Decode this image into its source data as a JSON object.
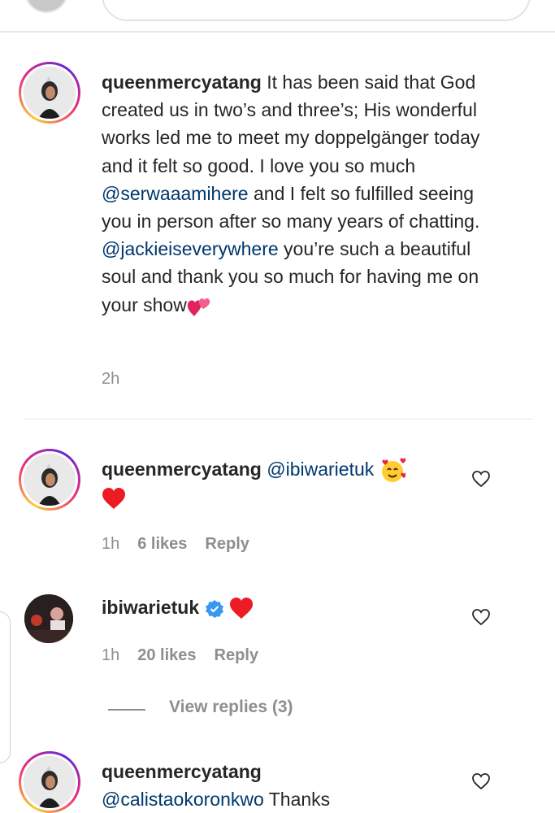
{
  "comments": [
    {
      "username": "queenmercyatang",
      "text_1": " It has been said that God created us in two’s and three’s; His wonderful works led me to meet my doppelgänger today and it felt so good. I love you so much ",
      "mention_1": "@serwaaamihere",
      "text_2": " and I felt so fulfilled seeing you in person after so many years of chatting. ",
      "mention_2": "@jackieiseverywhere",
      "text_3": " you’re such a beautiful soul and thank you so much for having me on your show",
      "time": "2h"
    },
    {
      "username": "queenmercyatang",
      "mention": "@ibiwarietuk",
      "time": "1h",
      "likes": "6 likes",
      "reply_label": "Reply"
    },
    {
      "username": "ibiwarietuk",
      "verified": true,
      "time": "1h",
      "likes": "20 likes",
      "reply_label": "Reply"
    },
    {
      "username": "queenmercyatang",
      "mention": "@calistaokoronkwo",
      "text": " Thanks"
    }
  ],
  "view_replies_label": "View replies (3)",
  "colors": {
    "mention": "#00376b",
    "muted": "#8e8e8e",
    "heart_red": "#ed1c24",
    "verified_blue": "#3897f0"
  },
  "icons": [
    "heart-outline-icon",
    "red-heart-emoji",
    "smiling-face-with-hearts-emoji",
    "two-hearts-emoji",
    "verified-badge-icon"
  ]
}
